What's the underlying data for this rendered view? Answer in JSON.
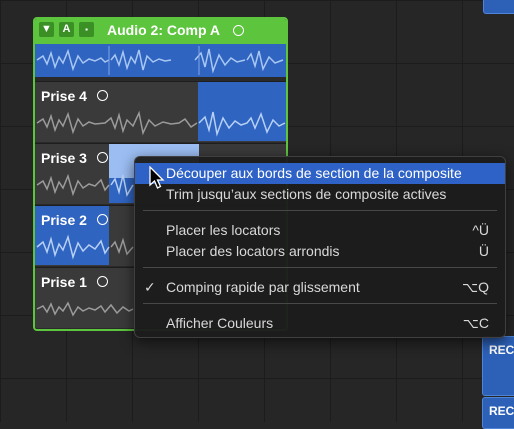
{
  "folder": {
    "title": "Audio 2: Comp A",
    "buttons": [
      "▼",
      "A",
      "▪"
    ],
    "takes": [
      {
        "label": "Prise 4"
      },
      {
        "label": "Prise 3"
      },
      {
        "label": "Prise 2"
      },
      {
        "label": "Prise 1"
      }
    ]
  },
  "right_regions": {
    "rec_label_1": "REC",
    "rec_label_2": "REC"
  },
  "menu": {
    "items": [
      {
        "label": "Découper aux bords de section de la composite",
        "shortcut": ""
      },
      {
        "label": "Trim jusqu’aux sections de composite actives",
        "shortcut": ""
      },
      {
        "label": "Placer les locators",
        "shortcut": "^Ü"
      },
      {
        "label": "Placer des locators arrondis",
        "shortcut": "Ü"
      },
      {
        "label": "Comping rapide par glissement",
        "shortcut": "⌥Q",
        "checked": "✓"
      },
      {
        "label": "Afficher Couleurs",
        "shortcut": "⌥C"
      }
    ]
  },
  "colors": {
    "folder_green": "#5dc43e",
    "region_blue": "#2f64c0",
    "menu_highlight": "#2e62c6"
  }
}
